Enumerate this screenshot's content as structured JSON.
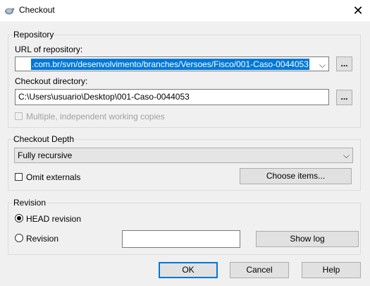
{
  "window": {
    "title": "Checkout",
    "close_glyph": "✕"
  },
  "repository": {
    "group_label": "Repository",
    "url_label": "URL of repository:",
    "url_value": ".com.br/svn/desenvolvimento/branches/Versoes/Fisco/001-Caso-0044053",
    "url_browse": "...",
    "dir_label": "Checkout directory:",
    "dir_value": "C:\\Users\\usuario\\Desktop\\001-Caso-0044053",
    "dir_browse": "...",
    "multiple_label": "Multiple, independent working copies",
    "multiple_checked": false
  },
  "depth": {
    "group_label": "Checkout Depth",
    "selected": "Fully recursive",
    "omit_label": "Omit externals",
    "omit_checked": false,
    "choose_items": "Choose items..."
  },
  "revision": {
    "group_label": "Revision",
    "head_label": "HEAD revision",
    "revision_label": "Revision",
    "revision_value": "",
    "show_log": "Show log",
    "selected": "head"
  },
  "buttons": {
    "ok": "OK",
    "cancel": "Cancel",
    "help": "Help"
  },
  "colors": {
    "accent": "#0078d7",
    "background": "#f0f0f0"
  }
}
